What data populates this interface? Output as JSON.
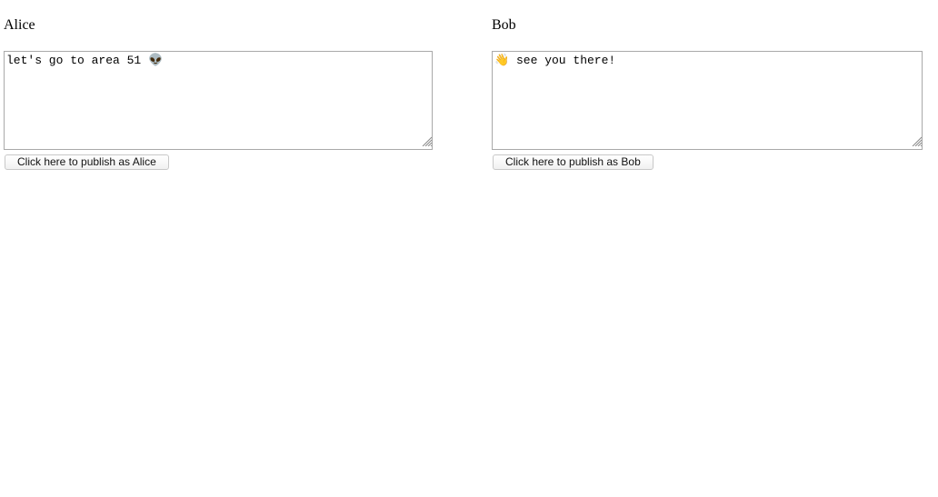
{
  "alice": {
    "name": "Alice",
    "text": "let's go to area 51 👽",
    "button_label": "Click here to publish as Alice"
  },
  "bob": {
    "name": "Bob",
    "text": "👋 see you there!",
    "button_label": "Click here to publish as Bob"
  },
  "icons": {
    "resize_grip": "resize-grip-icon"
  }
}
